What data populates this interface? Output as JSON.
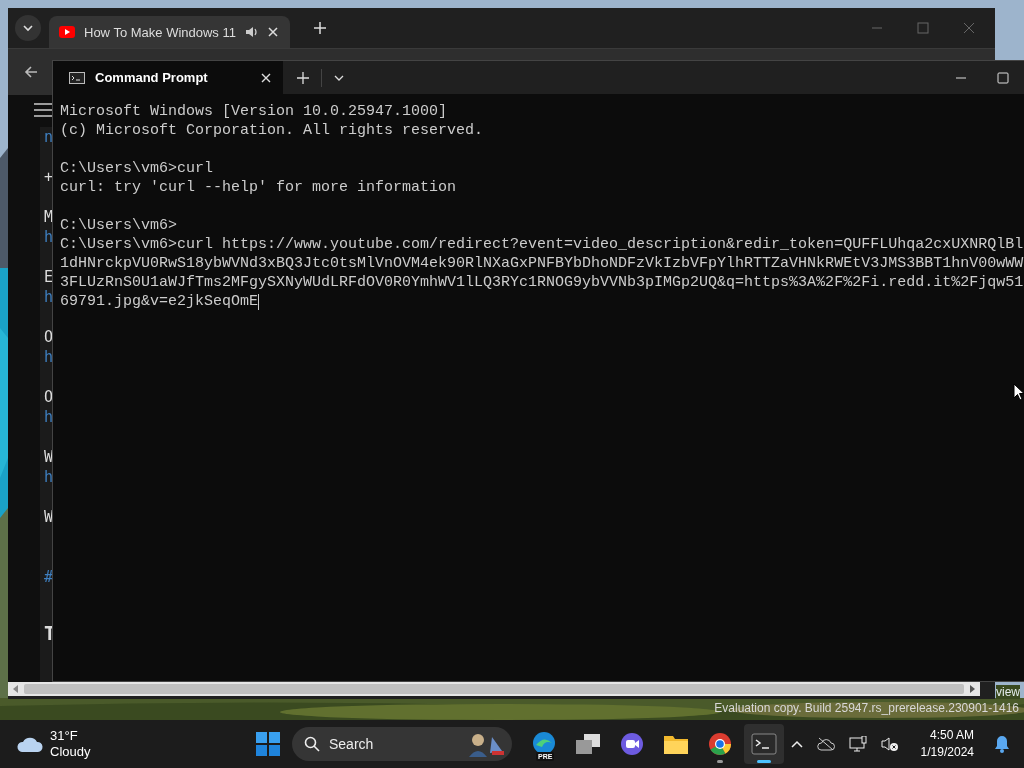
{
  "browser": {
    "tabs": [
      {
        "title": "How To Make Windows 11",
        "selected": true
      }
    ],
    "page_fragments": [
      {
        "text": "n",
        "kind": "link"
      },
      {
        "text": "+",
        "kind": "heading"
      },
      {
        "text": "M",
        "kind": "heading"
      },
      {
        "text": "h",
        "kind": "link"
      },
      {
        "text": "E",
        "kind": "heading"
      },
      {
        "text": "h",
        "kind": "link"
      },
      {
        "text": "O",
        "kind": "heading"
      },
      {
        "text": "h",
        "kind": "link"
      },
      {
        "text": "O",
        "kind": "heading"
      },
      {
        "text": "h",
        "kind": "link"
      },
      {
        "text": "W",
        "kind": "heading"
      },
      {
        "text": "h",
        "kind": "link"
      },
      {
        "text": "W",
        "kind": "heading"
      },
      {
        "text": "#",
        "kind": "section-link"
      },
      {
        "text": "T",
        "kind": "title"
      }
    ]
  },
  "terminal": {
    "tabs": [
      {
        "title": "Command Prompt",
        "selected": true
      }
    ],
    "blocks": [
      [
        "Microsoft Windows [Version 10.0.25947.1000]",
        "(c) Microsoft Corporation. All rights reserved."
      ],
      [
        "C:\\Users\\vm6>curl",
        "curl: try 'curl --help' for more information"
      ],
      [
        "C:\\Users\\vm6>",
        "C:\\Users\\vm6>curl https://www.youtube.com/redirect?event=video_description&redir_token=QUFFLUhqa2cxUXNRQlBl",
        "1dHNrckpVU0RwS18ybWVNd3xBQ3Jtc0tsMlVnOVM4ek90RlNXaGxPNFBYbDhoNDFzVkIzbVFpYlhRTTZaVHNkRWEtV3JMS3BBT1hnV00wWW",
        "3FLUzRnS0U1aWJfTms2MFgySXNyWUdLRFdOV0R0YmhWV1lLQ3RYc1RNOG9ybVVNb3pIMGp2UQ&q=https%3A%2F%2Fi.redd.it%2Fjqw51",
        "69791.jpg&v=e2jkSeqOmE"
      ]
    ]
  },
  "desktop": {
    "corner_text": "view",
    "watermark": "Evaluation copy. Build 25947.rs_prerelease.230901-1416"
  },
  "taskbar": {
    "weather": {
      "temperature": "31°F",
      "condition": "Cloudy"
    },
    "search": {
      "placeholder": "Search"
    },
    "apps": [
      {
        "kind": "edge",
        "badge": "PRE",
        "running": false,
        "active": false
      },
      {
        "kind": "task-view",
        "running": false,
        "active": false
      },
      {
        "kind": "meet",
        "running": false,
        "active": false
      },
      {
        "kind": "explorer",
        "running": false,
        "active": false
      },
      {
        "kind": "chrome",
        "running": true,
        "active": false
      },
      {
        "kind": "terminal",
        "running": true,
        "active": true
      }
    ],
    "clock": {
      "time": "4:50 AM",
      "date": "1/19/2024"
    }
  }
}
